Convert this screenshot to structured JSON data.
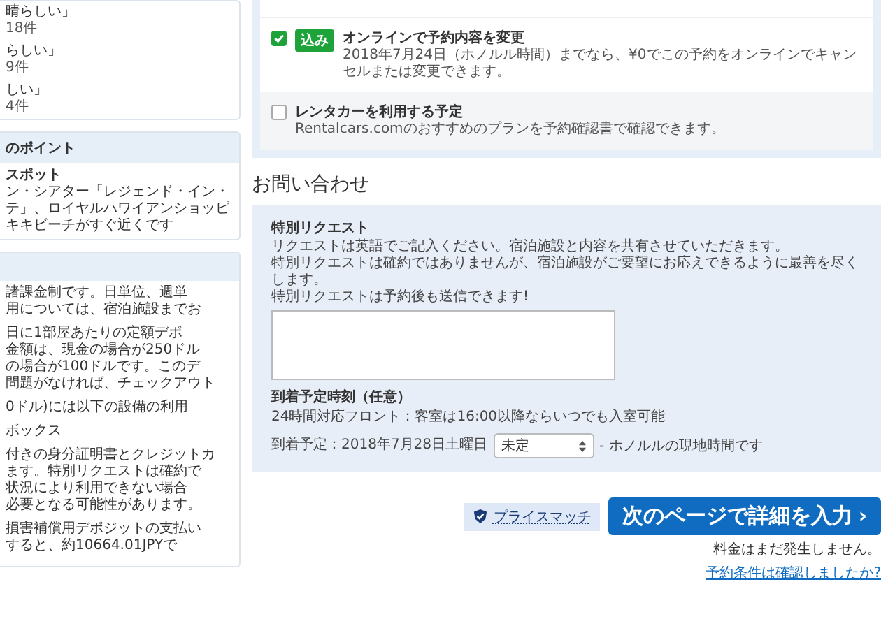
{
  "sidebar": {
    "reviews": [
      {
        "label": "晴らしい」",
        "count": "18件"
      },
      {
        "label": "らしい」",
        "count": "9件"
      },
      {
        "label": "しい」",
        "count": "4件"
      }
    ],
    "highlights": {
      "header": "のポイント",
      "title": "スポット",
      "lines": [
        "ン・シアター「レジェンド・イン・",
        "テ」、ロイヤルハワイアンショッピ",
        "キキビーチがすぐ近くです"
      ]
    },
    "policies": {
      "paragraphs": [
        [
          "諸課金制です。日単位、週単",
          "用については、宿泊施設までお"
        ],
        [
          "日に1部屋あたりの定額デポ",
          "金額は、現金の場合が250ドル",
          "の場合が100ドルです。このデ",
          "問題がなければ、チェックアウト"
        ],
        [
          "0ドル)には以下の設備の利用"
        ],
        [
          "ボックス"
        ],
        [
          "付きの身分証明書とクレジットカ",
          "ます。特別リクエストは確約で",
          "状況により利用できない場合",
          "必要となる可能性があります。"
        ],
        [
          "損害補償用デポジットの支払い",
          "すると、約10664.01JPYで"
        ]
      ]
    }
  },
  "options": [
    {
      "checked": true,
      "badge": "込み",
      "title": "オンラインで予約内容を変更",
      "description": "2018年7月24日（ホノルル時間）までなら、¥0でこの予約をオンラインでキャンセルまたは変更できます。"
    },
    {
      "checked": false,
      "title": "レンタカーを利用する予定",
      "description": "Rentalcars.comのおすすめのプランを予約確認書で確認できます。"
    }
  ],
  "contact": {
    "heading": "お問い合わせ",
    "special_request": {
      "label": "特別リクエスト",
      "lines": [
        "リクエストは英語でご記入ください。宿泊施設と内容を共有させていただきます。",
        "特別リクエストは確約ではありませんが、宿泊施設がご要望にお応えできるように最善を尽くします。",
        "特別リクエストは予約後も送信できます!"
      ]
    },
    "arrival": {
      "label": "到着予定時刻（任意）",
      "note": "24時間対応フロント：客室は16:00以降ならいつでも入室可能",
      "date_label": "到着予定：2018年7月28日土曜日",
      "select_value": "未定",
      "suffix": "- ホノルルの現地時間です"
    }
  },
  "footer": {
    "price_match": "プライスマッチ",
    "next_button": "次のページで詳細を入力",
    "next_arrow": "›",
    "note": "料金はまだ発生しません。",
    "link": "予約条件は確認しましたか?"
  }
}
